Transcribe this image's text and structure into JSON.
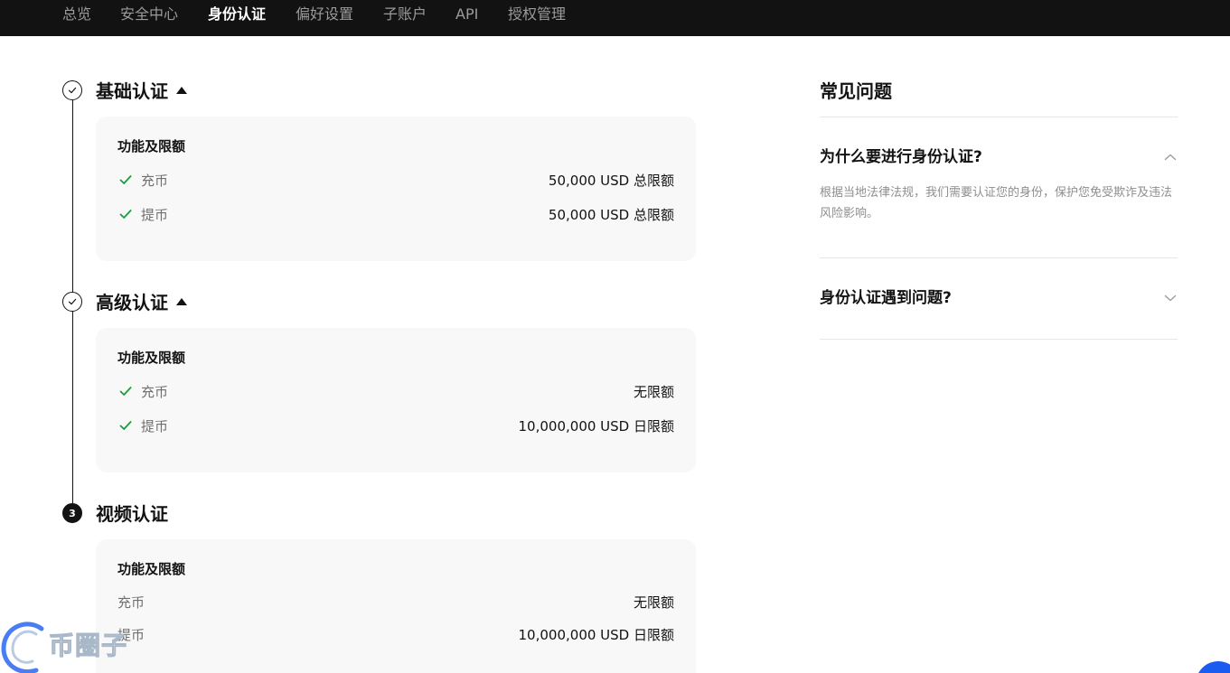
{
  "nav": {
    "items": [
      {
        "label": "总览",
        "active": false
      },
      {
        "label": "安全中心",
        "active": false
      },
      {
        "label": "身份认证",
        "active": true
      },
      {
        "label": "偏好设置",
        "active": false
      },
      {
        "label": "子账户",
        "active": false
      },
      {
        "label": "API",
        "active": false
      },
      {
        "label": "授权管理",
        "active": false
      }
    ]
  },
  "steps": [
    {
      "title": "基础认证",
      "status": "completed",
      "expanded": true,
      "card_title": "功能及限额",
      "rows": [
        {
          "label": "充币",
          "value": "50,000 USD 总限额",
          "checked": true
        },
        {
          "label": "提币",
          "value": "50,000 USD 总限额",
          "checked": true
        }
      ]
    },
    {
      "title": "高级认证",
      "status": "completed",
      "expanded": true,
      "card_title": "功能及限额",
      "rows": [
        {
          "label": "充币",
          "value": "无限额",
          "checked": true
        },
        {
          "label": "提币",
          "value": "10,000,000 USD 日限额",
          "checked": true
        }
      ]
    },
    {
      "title": "视频认证",
      "status": "pending",
      "number": "3",
      "expanded": true,
      "card_title": "功能及限额",
      "rows": [
        {
          "label": "充币",
          "value": "无限额",
          "checked": false
        },
        {
          "label": "提币",
          "value": "10,000,000 USD 日限额",
          "checked": false
        }
      ]
    }
  ],
  "faq": {
    "title": "常见问题",
    "items": [
      {
        "question": "为什么要进行身份认证?",
        "expanded": true,
        "answer": "根据当地法律法规，我们需要认证您的身份，保护您免受欺诈及违法风险影响。"
      },
      {
        "question": "身份认证遇到问题?",
        "expanded": false
      }
    ]
  },
  "watermark": {
    "text": "币圈子"
  },
  "colors": {
    "nav_bg": "#121212",
    "check_green": "#1f9b3f",
    "card_bg": "#f8f8f8",
    "fab_blue": "#1a5cf0"
  }
}
